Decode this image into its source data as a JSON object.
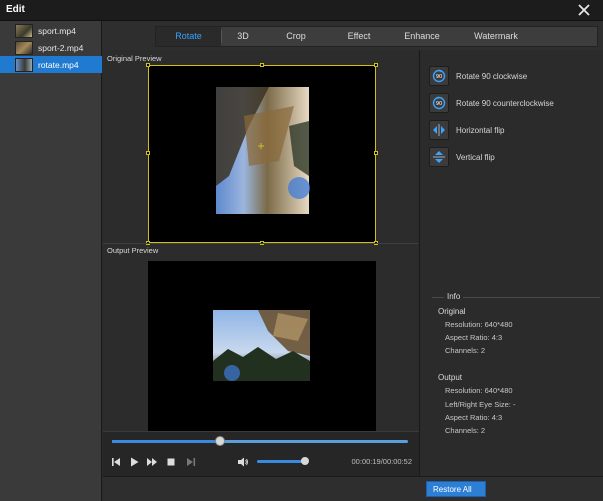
{
  "window": {
    "title": "Edit"
  },
  "files": [
    {
      "name": "sport.mp4",
      "selected": false
    },
    {
      "name": "sport-2.mp4",
      "selected": false
    },
    {
      "name": "rotate.mp4",
      "selected": true
    }
  ],
  "tabs": [
    {
      "label": "Rotate",
      "active": true
    },
    {
      "label": "3D",
      "active": false
    },
    {
      "label": "Crop",
      "active": false
    },
    {
      "label": "Effect",
      "active": false
    },
    {
      "label": "Enhance",
      "active": false
    },
    {
      "label": "Watermark",
      "active": false
    }
  ],
  "preview": {
    "original_label": "Original Preview",
    "output_label": "Output Preview"
  },
  "actions": [
    {
      "label": "Rotate 90 clockwise",
      "icon": "rotate-clockwise-icon"
    },
    {
      "label": "Rotate 90 counterclockwise",
      "icon": "rotate-counterclockwise-icon"
    },
    {
      "label": "Horizontal flip",
      "icon": "horizontal-flip-icon"
    },
    {
      "label": "Vertical flip",
      "icon": "vertical-flip-icon"
    }
  ],
  "info": {
    "heading": "Info",
    "original": {
      "title": "Original",
      "resolution": "Resolution: 640*480",
      "aspect": "Aspect Ratio: 4:3",
      "channels": "Channels: 2"
    },
    "output": {
      "title": "Output",
      "resolution": "Resolution: 640*480",
      "eye_size": "Left/Right Eye Size: -",
      "aspect": "Aspect Ratio: 4:3",
      "channels": "Channels: 2"
    }
  },
  "player": {
    "timecode": "00:00:19/00:00:52",
    "progress": 0.365,
    "volume": 0.97
  },
  "bottom": {
    "restore_label": "Restore All"
  },
  "colors": {
    "accent": "#1f7ad0",
    "crop_border": "#cfc01a"
  }
}
